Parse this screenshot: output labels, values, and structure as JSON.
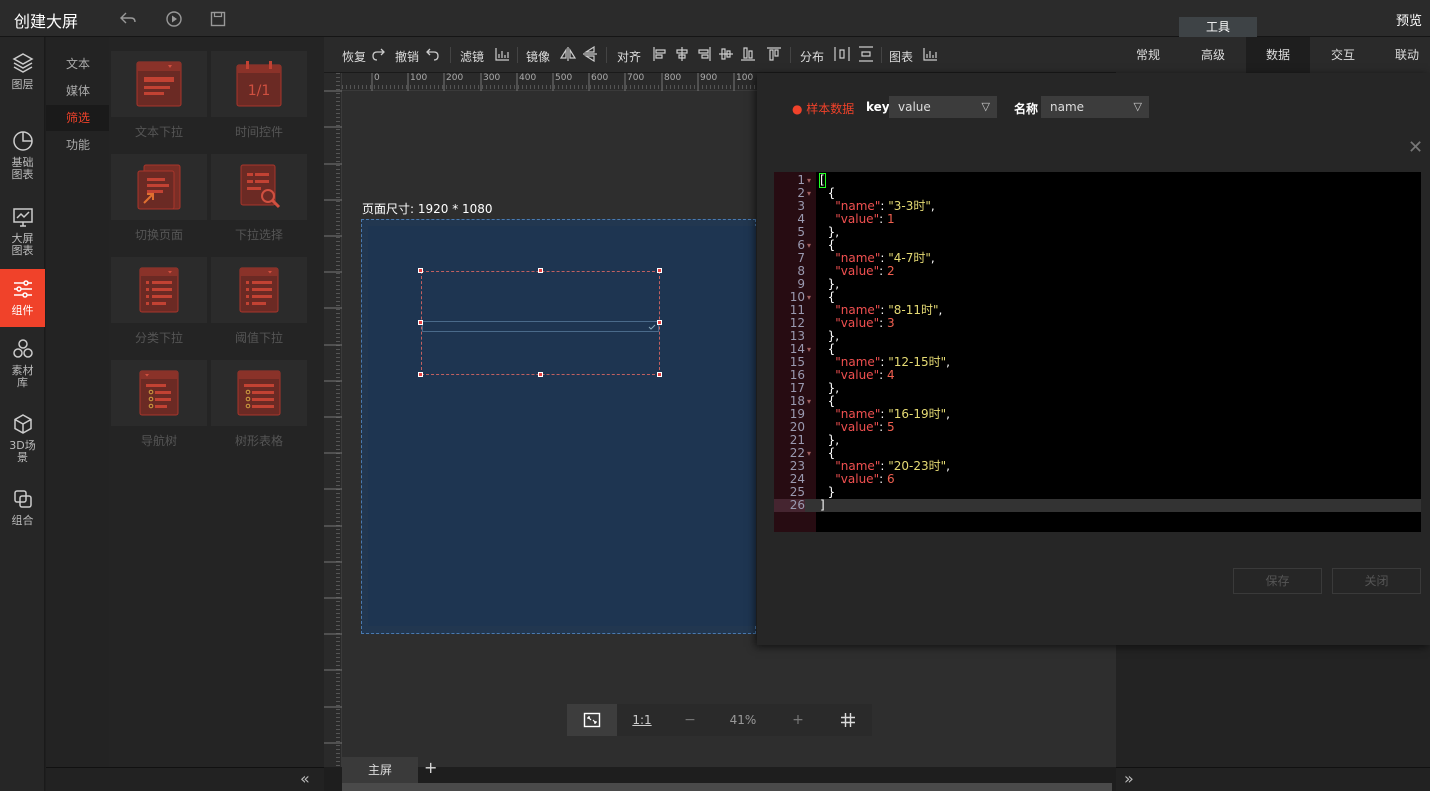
{
  "header": {
    "title": "创建大屏",
    "preview": "预览",
    "tools_tab": "工具"
  },
  "leftnav": [
    {
      "label": "图层",
      "icon": "layers-icon"
    },
    {
      "label": "基础图表",
      "icon": "pie-chart-icon"
    },
    {
      "label": "大屏图表",
      "icon": "monitor-chart-icon"
    },
    {
      "label": "组件",
      "icon": "sliders-icon",
      "active": true
    },
    {
      "label": "素材库",
      "icon": "material-icon"
    },
    {
      "label": "3D场景",
      "icon": "cube-icon"
    },
    {
      "label": "组合",
      "icon": "group-icon"
    }
  ],
  "subcategories": [
    {
      "label": "文本"
    },
    {
      "label": "媒体"
    },
    {
      "label": "筛选",
      "active": true
    },
    {
      "label": "功能"
    }
  ],
  "components": [
    {
      "label": "文本下拉",
      "icon": "text-dropdown-icon"
    },
    {
      "label": "时间控件",
      "icon": "calendar-icon"
    },
    {
      "label": "切换页面",
      "icon": "switch-page-icon"
    },
    {
      "label": "下拉选择",
      "icon": "dropdown-search-icon"
    },
    {
      "label": "分类下拉",
      "icon": "category-dropdown-icon"
    },
    {
      "label": "阈值下拉",
      "icon": "threshold-dropdown-icon"
    },
    {
      "label": "导航树",
      "icon": "nav-tree-icon"
    },
    {
      "label": "树形表格",
      "icon": "tree-table-icon"
    }
  ],
  "toolbar": {
    "redo": "恢复",
    "undo": "撤销",
    "filter": "滤镜",
    "mirror": "镜像",
    "align": "对齐",
    "distribute": "分布",
    "chart": "图表"
  },
  "ruler_marks": [
    "0",
    "100",
    "200",
    "300",
    "400",
    "500",
    "600",
    "700",
    "800",
    "900",
    "100"
  ],
  "canvas": {
    "page_size_label": "页面尺寸: 1920 * 1080",
    "zoom": "41%",
    "one_to_one": "1:1",
    "minus": "−",
    "plus": "+",
    "main_tab": "主屏",
    "add_tab": "+"
  },
  "right_tabs": [
    {
      "label": "常规"
    },
    {
      "label": "高级"
    },
    {
      "label": "数据",
      "active": true
    },
    {
      "label": "交互"
    },
    {
      "label": "联动"
    }
  ],
  "dialog": {
    "sample_label": "● 样本数据",
    "key_label": "key",
    "key_value": "value",
    "name_label": "名称",
    "name_value": "name",
    "save": "保存",
    "close": "关闭",
    "code_lines": [
      "[",
      "  {",
      "    \"name\": \"3-3时\",",
      "    \"value\": 1",
      "  },",
      "  {",
      "    \"name\": \"4-7时\",",
      "    \"value\": 2",
      "  },",
      "  {",
      "    \"name\": \"8-11时\",",
      "    \"value\": 3",
      "  },",
      "  {",
      "    \"name\": \"12-15时\",",
      "    \"value\": 4",
      "  },",
      "  {",
      "    \"name\": \"16-19时\",",
      "    \"value\": 5",
      "  },",
      "  {",
      "    \"name\": \"20-23时\",",
      "    \"value\": 6",
      "  }",
      "]"
    ]
  }
}
